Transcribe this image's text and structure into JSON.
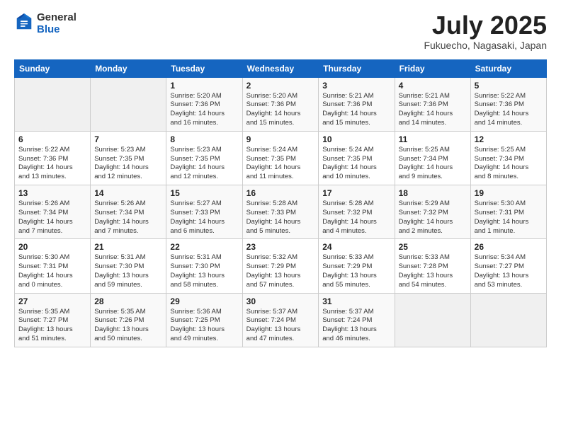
{
  "logo": {
    "general": "General",
    "blue": "Blue"
  },
  "header": {
    "month": "July 2025",
    "location": "Fukuecho, Nagasaki, Japan"
  },
  "weekdays": [
    "Sunday",
    "Monday",
    "Tuesday",
    "Wednesday",
    "Thursday",
    "Friday",
    "Saturday"
  ],
  "weeks": [
    [
      {
        "day": "",
        "detail": ""
      },
      {
        "day": "",
        "detail": ""
      },
      {
        "day": "1",
        "detail": "Sunrise: 5:20 AM\nSunset: 7:36 PM\nDaylight: 14 hours\nand 16 minutes."
      },
      {
        "day": "2",
        "detail": "Sunrise: 5:20 AM\nSunset: 7:36 PM\nDaylight: 14 hours\nand 15 minutes."
      },
      {
        "day": "3",
        "detail": "Sunrise: 5:21 AM\nSunset: 7:36 PM\nDaylight: 14 hours\nand 15 minutes."
      },
      {
        "day": "4",
        "detail": "Sunrise: 5:21 AM\nSunset: 7:36 PM\nDaylight: 14 hours\nand 14 minutes."
      },
      {
        "day": "5",
        "detail": "Sunrise: 5:22 AM\nSunset: 7:36 PM\nDaylight: 14 hours\nand 14 minutes."
      }
    ],
    [
      {
        "day": "6",
        "detail": "Sunrise: 5:22 AM\nSunset: 7:36 PM\nDaylight: 14 hours\nand 13 minutes."
      },
      {
        "day": "7",
        "detail": "Sunrise: 5:23 AM\nSunset: 7:35 PM\nDaylight: 14 hours\nand 12 minutes."
      },
      {
        "day": "8",
        "detail": "Sunrise: 5:23 AM\nSunset: 7:35 PM\nDaylight: 14 hours\nand 12 minutes."
      },
      {
        "day": "9",
        "detail": "Sunrise: 5:24 AM\nSunset: 7:35 PM\nDaylight: 14 hours\nand 11 minutes."
      },
      {
        "day": "10",
        "detail": "Sunrise: 5:24 AM\nSunset: 7:35 PM\nDaylight: 14 hours\nand 10 minutes."
      },
      {
        "day": "11",
        "detail": "Sunrise: 5:25 AM\nSunset: 7:34 PM\nDaylight: 14 hours\nand 9 minutes."
      },
      {
        "day": "12",
        "detail": "Sunrise: 5:25 AM\nSunset: 7:34 PM\nDaylight: 14 hours\nand 8 minutes."
      }
    ],
    [
      {
        "day": "13",
        "detail": "Sunrise: 5:26 AM\nSunset: 7:34 PM\nDaylight: 14 hours\nand 7 minutes."
      },
      {
        "day": "14",
        "detail": "Sunrise: 5:26 AM\nSunset: 7:34 PM\nDaylight: 14 hours\nand 7 minutes."
      },
      {
        "day": "15",
        "detail": "Sunrise: 5:27 AM\nSunset: 7:33 PM\nDaylight: 14 hours\nand 6 minutes."
      },
      {
        "day": "16",
        "detail": "Sunrise: 5:28 AM\nSunset: 7:33 PM\nDaylight: 14 hours\nand 5 minutes."
      },
      {
        "day": "17",
        "detail": "Sunrise: 5:28 AM\nSunset: 7:32 PM\nDaylight: 14 hours\nand 4 minutes."
      },
      {
        "day": "18",
        "detail": "Sunrise: 5:29 AM\nSunset: 7:32 PM\nDaylight: 14 hours\nand 2 minutes."
      },
      {
        "day": "19",
        "detail": "Sunrise: 5:30 AM\nSunset: 7:31 PM\nDaylight: 14 hours\nand 1 minute."
      }
    ],
    [
      {
        "day": "20",
        "detail": "Sunrise: 5:30 AM\nSunset: 7:31 PM\nDaylight: 14 hours\nand 0 minutes."
      },
      {
        "day": "21",
        "detail": "Sunrise: 5:31 AM\nSunset: 7:30 PM\nDaylight: 13 hours\nand 59 minutes."
      },
      {
        "day": "22",
        "detail": "Sunrise: 5:31 AM\nSunset: 7:30 PM\nDaylight: 13 hours\nand 58 minutes."
      },
      {
        "day": "23",
        "detail": "Sunrise: 5:32 AM\nSunset: 7:29 PM\nDaylight: 13 hours\nand 57 minutes."
      },
      {
        "day": "24",
        "detail": "Sunrise: 5:33 AM\nSunset: 7:29 PM\nDaylight: 13 hours\nand 55 minutes."
      },
      {
        "day": "25",
        "detail": "Sunrise: 5:33 AM\nSunset: 7:28 PM\nDaylight: 13 hours\nand 54 minutes."
      },
      {
        "day": "26",
        "detail": "Sunrise: 5:34 AM\nSunset: 7:27 PM\nDaylight: 13 hours\nand 53 minutes."
      }
    ],
    [
      {
        "day": "27",
        "detail": "Sunrise: 5:35 AM\nSunset: 7:27 PM\nDaylight: 13 hours\nand 51 minutes."
      },
      {
        "day": "28",
        "detail": "Sunrise: 5:35 AM\nSunset: 7:26 PM\nDaylight: 13 hours\nand 50 minutes."
      },
      {
        "day": "29",
        "detail": "Sunrise: 5:36 AM\nSunset: 7:25 PM\nDaylight: 13 hours\nand 49 minutes."
      },
      {
        "day": "30",
        "detail": "Sunrise: 5:37 AM\nSunset: 7:24 PM\nDaylight: 13 hours\nand 47 minutes."
      },
      {
        "day": "31",
        "detail": "Sunrise: 5:37 AM\nSunset: 7:24 PM\nDaylight: 13 hours\nand 46 minutes."
      },
      {
        "day": "",
        "detail": ""
      },
      {
        "day": "",
        "detail": ""
      }
    ]
  ]
}
